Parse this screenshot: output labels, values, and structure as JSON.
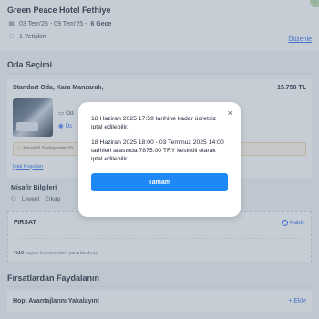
{
  "hotel": {
    "name": "Green Peace Hotel Fethiye",
    "dates": "03 Tem'25 - 09 Tem'25 -",
    "nights": "6 Gece",
    "guests": "1 Yetişkin",
    "edit_label": "Düzenle"
  },
  "room_section": {
    "title": "Oda Seçimi",
    "room_name": "Standart Oda, Kara Manzaralı,",
    "price": "15.750 TL",
    "meta_1": "Od",
    "meta_2": "Üc",
    "notice_text": "Mesafeli Sözleşmeler Yö... ... dahilinde cayma hakkı kullanılamaz. Ancak rez...",
    "cancel_link": "İptal Koşulları"
  },
  "guest_info": {
    "title": "Misafir Bilgileri",
    "first_name": "Levent",
    "last_name": "Erkap"
  },
  "firsat": {
    "title": "FIRSAT",
    "remove_label": "Kaldır",
    "percent": "%10",
    "description": "kupon indiriminden yararlandınız!"
  },
  "benefits": {
    "title": "Fırsatlardan Faydalanın",
    "hopi_label": "Hopi Avantajlarını Yakalayın!",
    "add_label": "+ Ekle"
  },
  "modal": {
    "text_1": "18 Haziran 2025 17:59 tarihine kadar ücretsiz iptal edilebilir.",
    "text_2": "18 Haziran 2025 18:00 - 03 Temmuz 2025 14:00 tarihleri arasında 7875.00 TRY kesintili olarak iptal edilebilir.",
    "button_label": "Tamam",
    "close_symbol": "×"
  },
  "colors": {
    "accent": "#1e88f5",
    "link": "#2563eb"
  }
}
